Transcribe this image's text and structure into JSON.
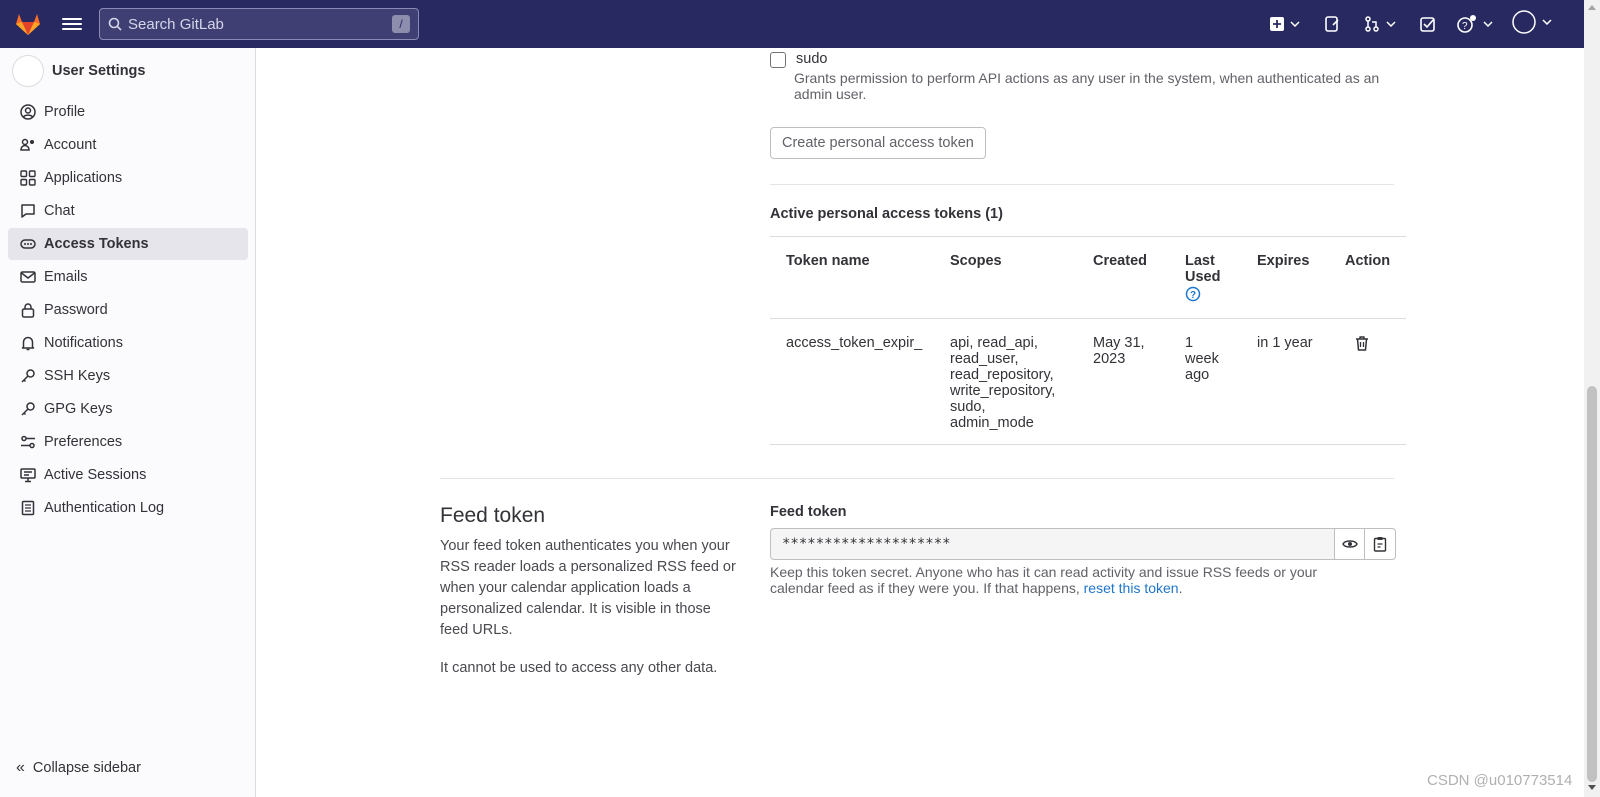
{
  "topbar": {
    "search_placeholder": "Search GitLab",
    "search_shortcut": "/",
    "colors": {
      "background": "#292961",
      "brand": "#fc6d26"
    },
    "icons": [
      "gitlab-logo",
      "hamburger-icon",
      "search-icon",
      "plus-square-icon",
      "issues-icon",
      "merge-request-icon",
      "todo-icon",
      "help-icon",
      "avatar"
    ]
  },
  "sidebar": {
    "title": "User Settings",
    "items": [
      {
        "label": "Profile",
        "icon": "profile-icon"
      },
      {
        "label": "Account",
        "icon": "account-icon"
      },
      {
        "label": "Applications",
        "icon": "applications-icon"
      },
      {
        "label": "Chat",
        "icon": "chat-icon"
      },
      {
        "label": "Access Tokens",
        "icon": "token-icon",
        "active": true
      },
      {
        "label": "Emails",
        "icon": "mail-icon"
      },
      {
        "label": "Password",
        "icon": "lock-icon"
      },
      {
        "label": "Notifications",
        "icon": "bell-icon"
      },
      {
        "label": "SSH Keys",
        "icon": "key-icon"
      },
      {
        "label": "GPG Keys",
        "icon": "key-icon"
      },
      {
        "label": "Preferences",
        "icon": "preferences-icon"
      },
      {
        "label": "Active Sessions",
        "icon": "monitor-icon"
      },
      {
        "label": "Authentication Log",
        "icon": "log-icon"
      }
    ],
    "collapse_label": "Collapse sidebar"
  },
  "main": {
    "sudo": {
      "label": "sudo",
      "help": "Grants permission to perform API actions as any user in the system, when authenticated as an admin user.",
      "checked": false
    },
    "create_button": "Create personal access token",
    "active_tokens_title": "Active personal access tokens (1)",
    "table": {
      "headers": {
        "name": "Token name",
        "scopes": "Scopes",
        "created": "Created",
        "last_used": "Last Used",
        "expires": "Expires",
        "action": "Action"
      },
      "row": {
        "name": "access_token_expir_",
        "scopes": "api, read_api, read_user, read_repository, write_repository, sudo, admin_mode",
        "created": "May 31, 2023",
        "last_used": "1 week ago",
        "expires": "in 1 year"
      }
    },
    "feed": {
      "heading": "Feed token",
      "description": "Your feed token authenticates you when your RSS reader loads a personalized RSS feed or when your calendar application loads a personalized calendar. It is visible in those feed URLs.",
      "description2": "It cannot be used to access any other data.",
      "label": "Feed token",
      "value": "********************",
      "help_text": "Keep this token secret. Anyone who has it can read activity and issue RSS feeds or your calendar feed as if they were you. If that happens,",
      "reset_link": "reset this token",
      "period": "."
    }
  },
  "watermark": "CSDN @u010773514"
}
